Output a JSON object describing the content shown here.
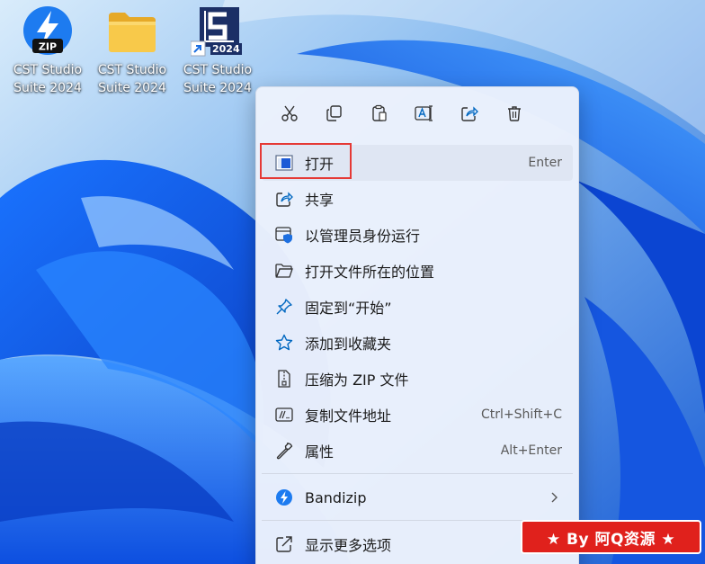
{
  "desktop": {
    "icons": [
      {
        "label": "CST Studio\nSuite 2024",
        "icon": "zip-archive-icon"
      },
      {
        "label": "CST Studio\nSuite 2024",
        "icon": "folder-icon"
      },
      {
        "label": "CST Studio\nSuite 2024",
        "icon": "cst-shortcut-icon",
        "badge": "2024"
      }
    ]
  },
  "context_menu": {
    "toolbar": [
      "cut-icon",
      "copy-icon",
      "paste-icon",
      "rename-icon",
      "share-icon",
      "delete-icon"
    ],
    "items": [
      {
        "label": "打开",
        "shortcut": "Enter",
        "icon": "open-app-icon",
        "highlighted": true
      },
      {
        "label": "共享",
        "shortcut": "",
        "icon": "share-icon"
      },
      {
        "label": "以管理员身份运行",
        "shortcut": "",
        "icon": "admin-shield-icon"
      },
      {
        "label": "打开文件所在的位置",
        "shortcut": "",
        "icon": "folder-open-icon"
      },
      {
        "label": "固定到“开始”",
        "shortcut": "",
        "icon": "pin-icon"
      },
      {
        "label": "添加到收藏夹",
        "shortcut": "",
        "icon": "star-icon"
      },
      {
        "label": "压缩为 ZIP 文件",
        "shortcut": "",
        "icon": "zip-file-icon"
      },
      {
        "label": "复制文件地址",
        "shortcut": "Ctrl+Shift+C",
        "icon": "copy-path-icon"
      },
      {
        "label": "属性",
        "shortcut": "Alt+Enter",
        "icon": "wrench-icon"
      }
    ],
    "bandizip": {
      "label": "Bandizip",
      "icon": "bandizip-icon"
    },
    "more": {
      "label": "显示更多选项",
      "icon": "more-options-icon"
    }
  },
  "watermark": {
    "text": "★ By 阿Q资源 ★"
  },
  "colors": {
    "accent": "#0067c0",
    "highlight_box": "#e53935",
    "watermark_bg": "#e0211c"
  }
}
